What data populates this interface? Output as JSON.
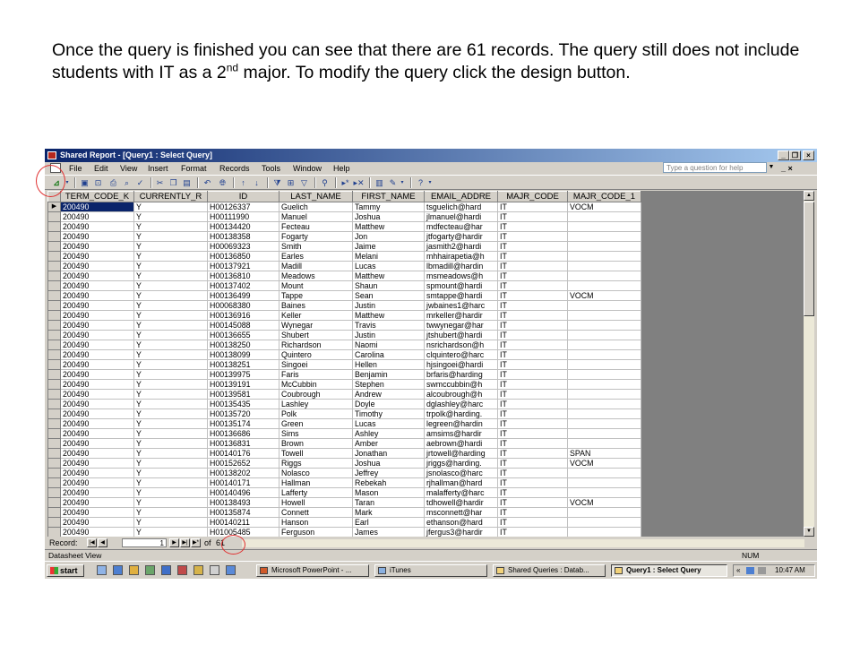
{
  "caption": {
    "before_sup": "Once the query is finished you can see that there are 61 records.  The query still does not include students with IT as a 2",
    "sup": "nd",
    "after_sup": " major.  To modify the query click the design button."
  },
  "window": {
    "title": "Shared Report - [Query1 : Select Query]",
    "minimize": "_",
    "restore": "❐",
    "close": "×"
  },
  "menu": [
    "File",
    "Edit",
    "View",
    "Insert",
    "Format",
    "Records",
    "Tools",
    "Window",
    "Help"
  ],
  "help_placeholder": "Type a question for help",
  "doc_controls": "_ ×",
  "grid": {
    "columns": [
      "TERM_CODE_K",
      "CURRENTLY_R",
      "ID",
      "LAST_NAME",
      "FIRST_NAME",
      "EMAIL_ADDRE",
      "MAJR_CODE",
      "MAJR_CODE_1"
    ],
    "rows": [
      [
        "200490",
        "Y",
        "H00126337",
        "Guelich",
        "Tammy",
        "tsguelich@hard",
        "IT",
        "VOCM"
      ],
      [
        "200490",
        "Y",
        "H00111990",
        "Manuel",
        "Joshua",
        "jlmanuel@hardi",
        "IT",
        ""
      ],
      [
        "200490",
        "Y",
        "H00134420",
        "Fecteau",
        "Matthew",
        "mdfecteau@har",
        "IT",
        ""
      ],
      [
        "200490",
        "Y",
        "H00138358",
        "Fogarty",
        "Jon",
        "jtfogarty@hardir",
        "IT",
        ""
      ],
      [
        "200490",
        "Y",
        "H00069323",
        "Smith",
        "Jaime",
        "jasmith2@hardi",
        "IT",
        ""
      ],
      [
        "200490",
        "Y",
        "H00136850",
        "Earles",
        "Melani",
        "mhhairapetia@h",
        "IT",
        ""
      ],
      [
        "200490",
        "Y",
        "H00137921",
        "Madill",
        "Lucas",
        "lbmadill@hardin",
        "IT",
        ""
      ],
      [
        "200490",
        "Y",
        "H00136810",
        "Meadows",
        "Matthew",
        "msmeadows@h",
        "IT",
        ""
      ],
      [
        "200490",
        "Y",
        "H00137402",
        "Mount",
        "Shaun",
        "spmount@hardi",
        "IT",
        ""
      ],
      [
        "200490",
        "Y",
        "H00136499",
        "Tappe",
        "Sean",
        "smtappe@hardi",
        "IT",
        "VOCM"
      ],
      [
        "200490",
        "Y",
        "H00068380",
        "Baines",
        "Justin",
        "jwbaines1@harc",
        "IT",
        ""
      ],
      [
        "200490",
        "Y",
        "H00136916",
        "Keller",
        "Matthew",
        "mrkeller@hardir",
        "IT",
        ""
      ],
      [
        "200490",
        "Y",
        "H00145088",
        "Wynegar",
        "Travis",
        "twwynegar@har",
        "IT",
        ""
      ],
      [
        "200490",
        "Y",
        "H00136655",
        "Shubert",
        "Justin",
        "jtshubert@hardi",
        "IT",
        ""
      ],
      [
        "200490",
        "Y",
        "H00138250",
        "Richardson",
        "Naomi",
        "nsrichardson@h",
        "IT",
        ""
      ],
      [
        "200490",
        "Y",
        "H00138099",
        "Quintero",
        "Carolina",
        "clquintero@harc",
        "IT",
        ""
      ],
      [
        "200490",
        "Y",
        "H00138251",
        "Singoei",
        "Hellen",
        "hjsingoei@hardi",
        "IT",
        ""
      ],
      [
        "200490",
        "Y",
        "H00139975",
        "Faris",
        "Benjamin",
        "brfaris@harding",
        "IT",
        ""
      ],
      [
        "200490",
        "Y",
        "H00139191",
        "McCubbin",
        "Stephen",
        "swmccubbin@h",
        "IT",
        ""
      ],
      [
        "200490",
        "Y",
        "H00139581",
        "Coubrough",
        "Andrew",
        "alcoubrough@h",
        "IT",
        ""
      ],
      [
        "200490",
        "Y",
        "H00135435",
        "Lashley",
        "Doyle",
        "dglashley@harc",
        "IT",
        ""
      ],
      [
        "200490",
        "Y",
        "H00135720",
        "Polk",
        "Timothy",
        "trpolk@harding.",
        "IT",
        ""
      ],
      [
        "200490",
        "Y",
        "H00135174",
        "Green",
        "Lucas",
        "legreen@hardin",
        "IT",
        ""
      ],
      [
        "200490",
        "Y",
        "H00136686",
        "Sims",
        "Ashley",
        "amsims@hardir",
        "IT",
        ""
      ],
      [
        "200490",
        "Y",
        "H00136831",
        "Brown",
        "Amber",
        "aebrown@hardi",
        "IT",
        ""
      ],
      [
        "200490",
        "Y",
        "H00140176",
        "Towell",
        "Jonathan",
        "jrtowell@harding",
        "IT",
        "SPAN"
      ],
      [
        "200490",
        "Y",
        "H00152652",
        "Riggs",
        "Joshua",
        "jriggs@harding.",
        "IT",
        "VOCM"
      ],
      [
        "200490",
        "Y",
        "H00138202",
        "Nolasco",
        "Jeffrey",
        "jsnolasco@harc",
        "IT",
        ""
      ],
      [
        "200490",
        "Y",
        "H00140171",
        "Hallman",
        "Rebekah",
        "rjhallman@hard",
        "IT",
        ""
      ],
      [
        "200490",
        "Y",
        "H00140496",
        "Lafferty",
        "Mason",
        "malafferty@harc",
        "IT",
        ""
      ],
      [
        "200490",
        "Y",
        "H00138493",
        "Howell",
        "Taran",
        "tdhowell@hardir",
        "IT",
        "VOCM"
      ],
      [
        "200490",
        "Y",
        "H00135874",
        "Connett",
        "Mark",
        "msconnett@har",
        "IT",
        ""
      ],
      [
        "200490",
        "Y",
        "H00140211",
        "Hanson",
        "Earl",
        "ethanson@hard",
        "IT",
        ""
      ],
      [
        "200490",
        "Y",
        "H01005485",
        "Ferguson",
        "James",
        "jfergus3@hardir",
        "IT",
        ""
      ]
    ]
  },
  "navigator": {
    "record_label": "Record:",
    "current": "1",
    "of_label": "of",
    "total": "61",
    "btn_first": "|◀",
    "btn_prev": "◀",
    "btn_next": "▶",
    "btn_last": "▶|",
    "btn_new": "▶*"
  },
  "status": {
    "left": "Datasheet View",
    "num": "NUM"
  },
  "taskbar": {
    "start": "start",
    "tasks": [
      "Microsoft PowerPoint - ...",
      "iTunes",
      "Shared Queries : Datab...",
      "Query1 : Select Query"
    ],
    "tray_chevron": "«",
    "clock": "10:47 AM"
  },
  "colors": {
    "title_gradient_start": "#0a246a",
    "annotation_circle": "#e03030",
    "face": "#d4d0c8"
  }
}
